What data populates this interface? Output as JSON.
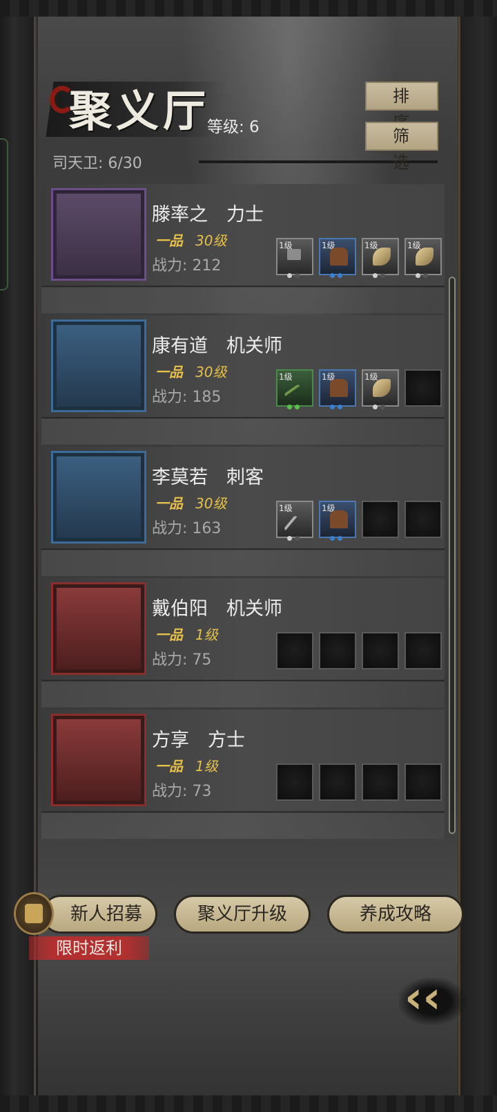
{
  "header": {
    "title": "聚义厅",
    "level_label": "等级: 6",
    "guard_count": "司天卫: 6/30",
    "sort_label": "排序",
    "filter_label": "筛选"
  },
  "heroes": [
    {
      "name": "滕率之　力士",
      "rank": "一品",
      "level": "30级",
      "power": "战力: 212",
      "portrait_frame": "purple",
      "equipment": [
        {
          "level": "1级",
          "icon": "hammer-icon",
          "rarity": "gray"
        },
        {
          "level": "1级",
          "icon": "armor-icon",
          "rarity": "blue"
        },
        {
          "level": "1级",
          "icon": "horn-icon",
          "rarity": "gray"
        },
        {
          "level": "1级",
          "icon": "horn-icon",
          "rarity": "gray"
        }
      ]
    },
    {
      "name": "康有道　机关师",
      "rank": "一品",
      "level": "30级",
      "power": "战力: 185",
      "portrait_frame": "blue",
      "equipment": [
        {
          "level": "1级",
          "icon": "crossbow-icon",
          "rarity": "green"
        },
        {
          "level": "1级",
          "icon": "armor-icon",
          "rarity": "blue"
        },
        {
          "level": "1级",
          "icon": "horn-icon",
          "rarity": "gray"
        },
        {
          "level": "",
          "icon": "empty-slot",
          "rarity": "empty"
        }
      ]
    },
    {
      "name": "李莫若　刺客",
      "rank": "一品",
      "level": "30级",
      "power": "战力: 163",
      "portrait_frame": "blue",
      "equipment": [
        {
          "level": "1级",
          "icon": "dagger-icon",
          "rarity": "gray"
        },
        {
          "level": "1级",
          "icon": "armor-icon",
          "rarity": "blue"
        },
        {
          "level": "",
          "icon": "empty-slot",
          "rarity": "empty"
        },
        {
          "level": "",
          "icon": "empty-slot",
          "rarity": "empty"
        }
      ]
    },
    {
      "name": "戴伯阳　机关师",
      "rank": "一品",
      "level": "1级",
      "power": "战力: 75",
      "portrait_frame": "red",
      "equipment": [
        {
          "level": "",
          "icon": "empty-slot",
          "rarity": "empty"
        },
        {
          "level": "",
          "icon": "empty-slot",
          "rarity": "empty"
        },
        {
          "level": "",
          "icon": "empty-slot",
          "rarity": "empty"
        },
        {
          "level": "",
          "icon": "empty-slot",
          "rarity": "empty"
        }
      ]
    },
    {
      "name": "方享　方士",
      "rank": "一品",
      "level": "1级",
      "power": "战力: 73",
      "portrait_frame": "red",
      "equipment": [
        {
          "level": "",
          "icon": "empty-slot",
          "rarity": "empty"
        },
        {
          "level": "",
          "icon": "empty-slot",
          "rarity": "empty"
        },
        {
          "level": "",
          "icon": "empty-slot",
          "rarity": "empty"
        },
        {
          "level": "",
          "icon": "empty-slot",
          "rarity": "empty"
        }
      ]
    }
  ],
  "footer": {
    "recruit_label": "新人招募",
    "upgrade_label": "聚义厅升级",
    "guide_label": "养成攻略",
    "limited_tag": "限时返利",
    "back_icon": "double-chevron-left-icon"
  }
}
